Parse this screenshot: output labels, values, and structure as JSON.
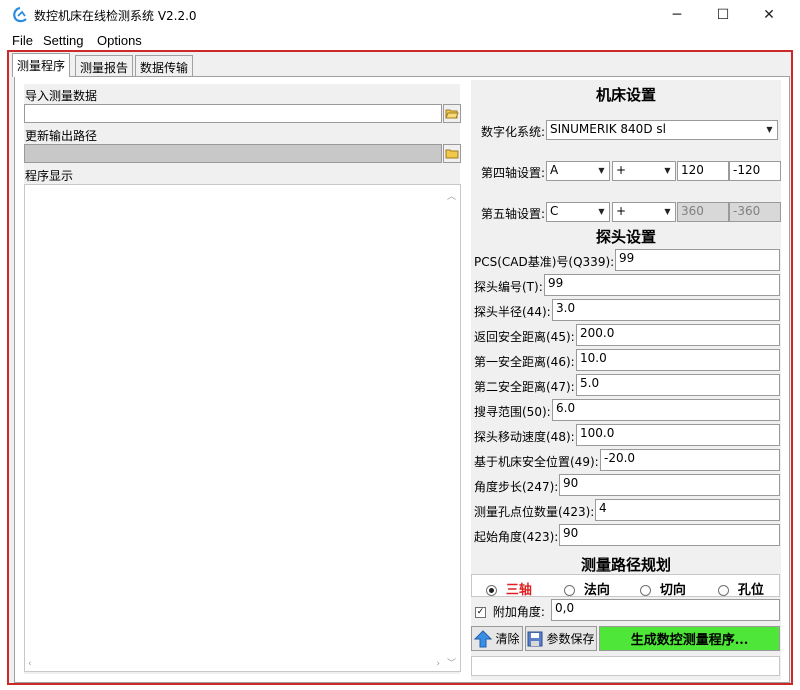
{
  "window": {
    "title": "数控机床在线检测系统 V2.2.0",
    "minimize": "─",
    "maximize": "☐",
    "close": "✕"
  },
  "menu": [
    "File",
    "Setting",
    "Options"
  ],
  "tabs": [
    "测量程序",
    "测量报告",
    "数据传输"
  ],
  "left": {
    "import_label": "导入测量数据",
    "import_value": "",
    "output_label": "更新输出路径",
    "output_value": "",
    "program_label": "程序显示",
    "program_text": ""
  },
  "machine": {
    "title": "机床设置",
    "numeric_label": "数字化系统:",
    "numeric_value": "SINUMERIK 840D sl",
    "axis4_label": "第四轴设置:",
    "axis4_axis": "A",
    "axis4_dir": "+",
    "axis4_max": "120",
    "axis4_min": "-120",
    "axis5_label": "第五轴设置:",
    "axis5_axis": "C",
    "axis5_dir": "+",
    "axis5_max": "360",
    "axis5_min": "-360"
  },
  "probe": {
    "title": "探头设置",
    "rows": [
      {
        "label": "PCS(CAD基准)号(Q339):",
        "value": "99"
      },
      {
        "label": "探头编号(T):",
        "value": "99"
      },
      {
        "label": "探头半径(44):",
        "value": "3.0"
      },
      {
        "label": "返回安全距离(45):",
        "value": "200.0"
      },
      {
        "label": "第一安全距离(46):",
        "value": "10.0"
      },
      {
        "label": "第二安全距离(47):",
        "value": "5.0"
      },
      {
        "label": "搜寻范围(50):",
        "value": "6.0"
      },
      {
        "label": "探头移动速度(48):",
        "value": "100.0"
      },
      {
        "label": "基于机床安全位置(49):",
        "value": "-20.0"
      },
      {
        "label": "角度步长(247):",
        "value": "90"
      },
      {
        "label": "测量孔点位数量(423):",
        "value": "4"
      },
      {
        "label": "起始角度(423):",
        "value": "90"
      }
    ]
  },
  "path": {
    "title": "测量路径规划",
    "options": [
      "三轴",
      "法向",
      "切向",
      "孔位"
    ],
    "selected": "三轴",
    "extra_angle_label": "附加角度:",
    "extra_angle_checked": true,
    "extra_angle_value": "0,0"
  },
  "actions": {
    "clear": "清除",
    "save_params": "参数保存",
    "generate": "生成数控测量程序...",
    "status": ""
  },
  "colors": {
    "frame_border": "#cc2a2a",
    "generate_bg": "#4ee639",
    "selected_radio_text": "#e02020"
  }
}
